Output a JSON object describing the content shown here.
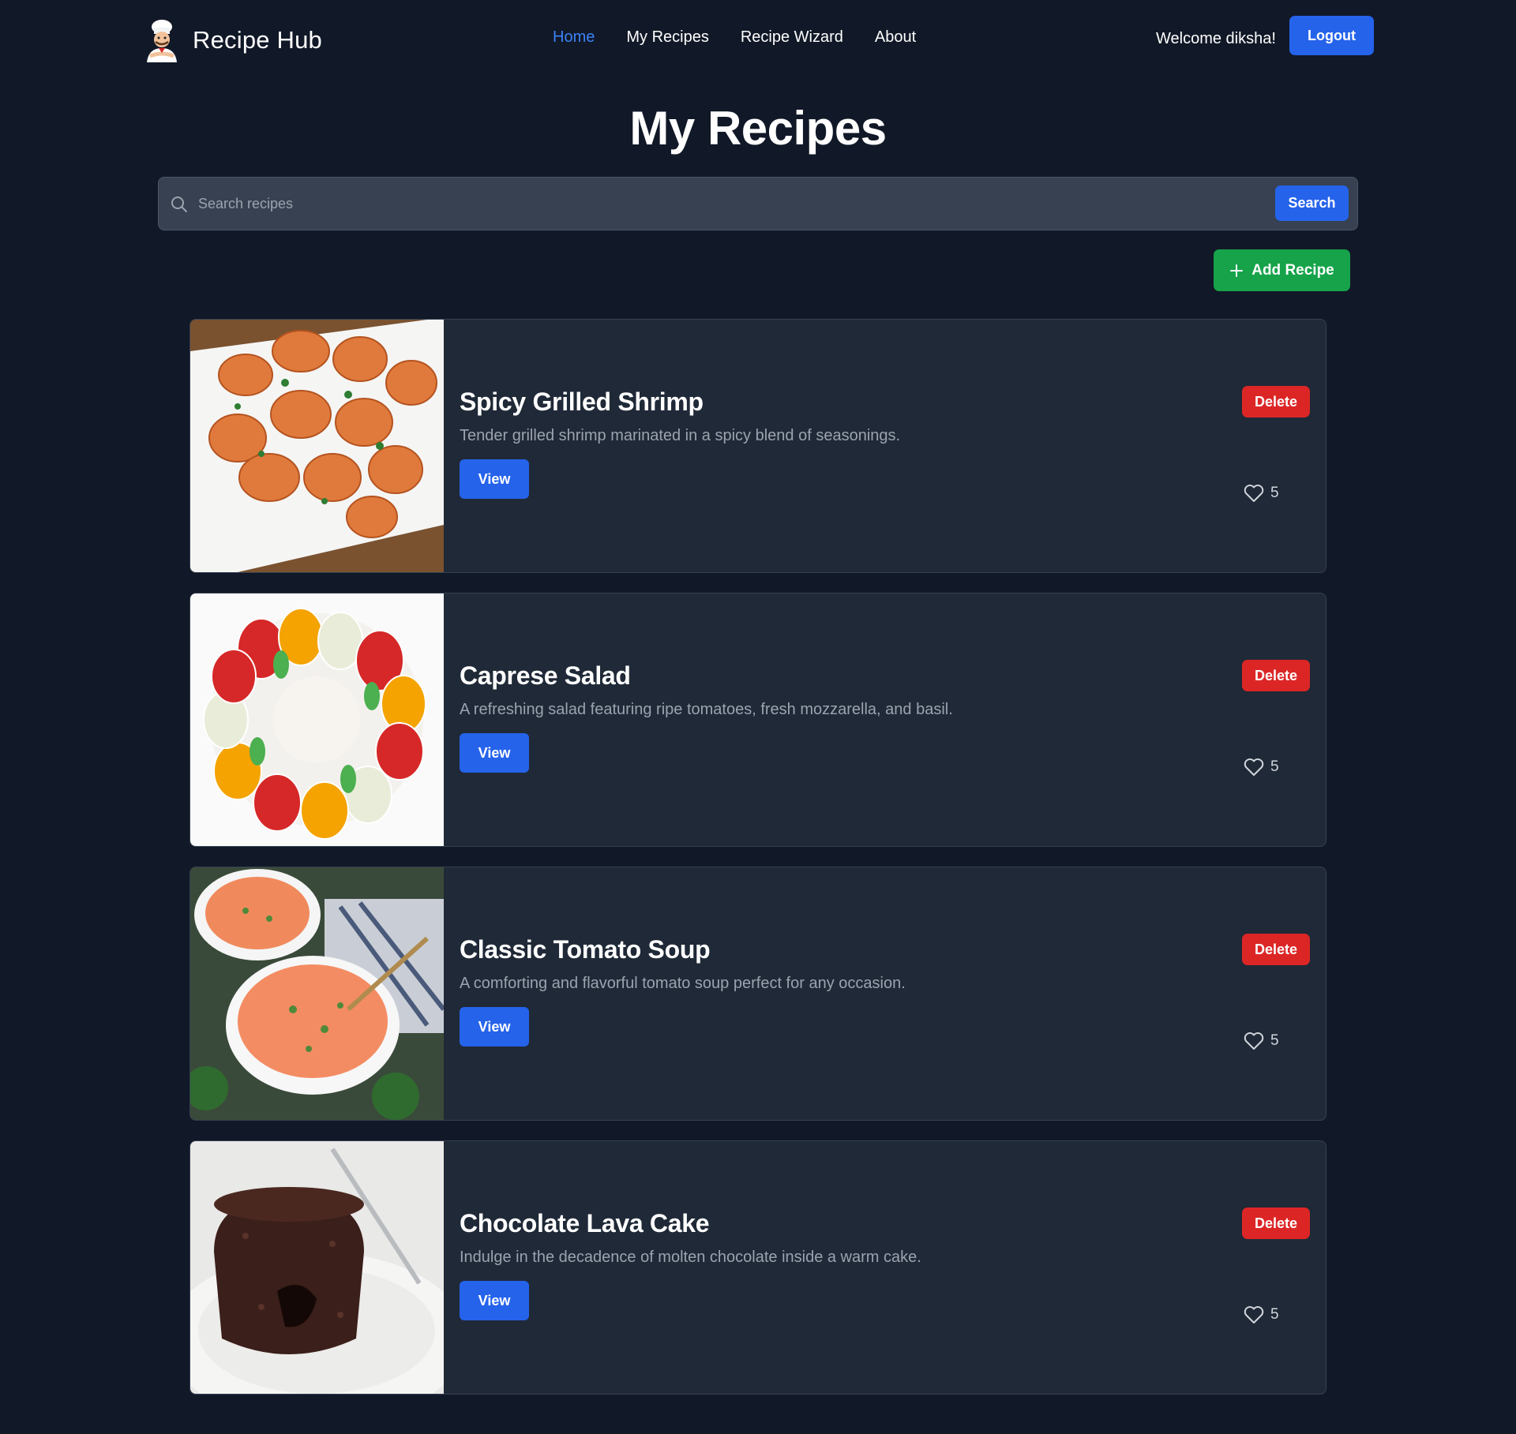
{
  "brand": {
    "name": "Recipe Hub",
    "logo_icon": "chef-icon"
  },
  "nav": {
    "items": [
      {
        "label": "Home",
        "active": true
      },
      {
        "label": "My Recipes",
        "active": false
      },
      {
        "label": "Recipe Wizard",
        "active": false
      },
      {
        "label": "About",
        "active": false
      }
    ]
  },
  "user": {
    "welcome": "Welcome diksha!",
    "logout_label": "Logout"
  },
  "page": {
    "title": "My Recipes"
  },
  "search": {
    "placeholder": "Search recipes",
    "value": "",
    "button_label": "Search"
  },
  "add_recipe_label": "Add Recipe",
  "recipes": [
    {
      "title": "Spicy Grilled Shrimp",
      "description": "Tender grilled shrimp marinated in a spicy blend of seasonings.",
      "view_label": "View",
      "delete_label": "Delete",
      "likes": "5"
    },
    {
      "title": "Caprese Salad",
      "description": "A refreshing salad featuring ripe tomatoes, fresh mozzarella, and basil.",
      "view_label": "View",
      "delete_label": "Delete",
      "likes": "5"
    },
    {
      "title": "Classic Tomato Soup",
      "description": "A comforting and flavorful tomato soup perfect for any occasion.",
      "view_label": "View",
      "delete_label": "Delete",
      "likes": "5"
    },
    {
      "title": "Chocolate Lava Cake",
      "description": "Indulge in the decadence of molten chocolate inside a warm cake.",
      "view_label": "View",
      "delete_label": "Delete",
      "likes": "5"
    }
  ],
  "colors": {
    "background": "#111827",
    "card": "#1f2937",
    "primary": "#2563eb",
    "success": "#16a34a",
    "danger": "#dc2626",
    "active_link": "#3b82f6"
  }
}
